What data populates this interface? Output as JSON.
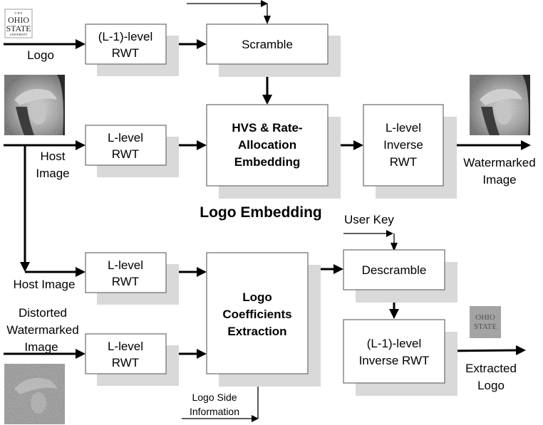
{
  "diagram": {
    "section_title": "Logo Embedding",
    "embedding": {
      "logo_input_label": "Logo",
      "host_input_label": [
        "Host",
        "Image"
      ],
      "output_label": [
        "Watermarked",
        "Image"
      ],
      "blocks": {
        "logo_rwt": [
          "(L-1)-level",
          "RWT"
        ],
        "scramble": [
          "Scramble"
        ],
        "host_rwt": [
          "L-level",
          "RWT"
        ],
        "hvs_embedding": [
          "HVS & Rate-",
          "Allocation",
          "Embedding"
        ],
        "inverse_rwt": [
          "L-level",
          "Inverse",
          "RWT"
        ]
      }
    },
    "extraction": {
      "host_input_label": "Host Image",
      "distorted_input_label": [
        "Distorted",
        "Watermarked",
        "Image"
      ],
      "user_key_label": "User Key",
      "side_info_label": [
        "Logo Side",
        "Information"
      ],
      "output_label": [
        "Extracted",
        "Logo"
      ],
      "blocks": {
        "host_rwt": [
          "L-level",
          "RWT"
        ],
        "distorted_rwt": [
          "L-level",
          "RWT"
        ],
        "coeff_extraction": [
          "Logo",
          "Coefficients",
          "Extraction"
        ],
        "descramble": [
          "Descramble"
        ],
        "inverse_rwt": [
          "(L-1)-level",
          "Inverse RWT"
        ]
      }
    },
    "logo_image": {
      "lines": [
        "T  H  E",
        "OHIO",
        "STATE",
        "UNIVERSITY"
      ]
    },
    "thumbnails": {
      "host": "host-image-thumbnail",
      "watermarked": "watermarked-image-thumbnail",
      "distorted": "distorted-image-thumbnail",
      "extracted_logo": "extracted-logo-thumbnail"
    }
  }
}
